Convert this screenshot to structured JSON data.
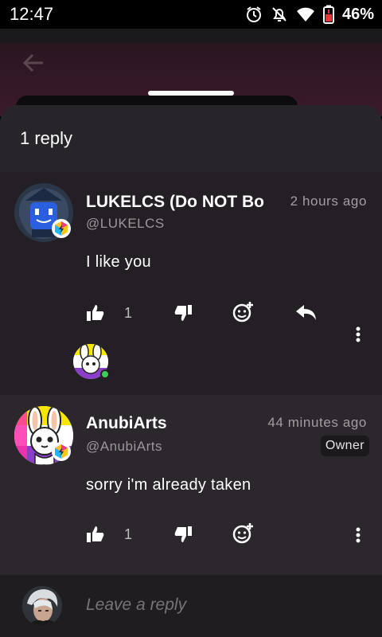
{
  "status_bar": {
    "time": "12:47",
    "battery": "46%",
    "icons": [
      "alarm-icon",
      "bell-off-icon",
      "wifi-icon",
      "battery-low-icon"
    ]
  },
  "sheet": {
    "title": "1 reply"
  },
  "comments": [
    {
      "name": "LUKELCS (Do NOT Bo",
      "handle": "@LUKELCS",
      "time": "2 hours ago",
      "text": "I like you",
      "likes": "1"
    },
    {
      "name": "AnubiArts",
      "handle": "@AnubiArts",
      "time": "44 minutes ago",
      "owner_label": "Owner",
      "text": "sorry i'm already taken",
      "likes": "1"
    }
  ],
  "reply_bar": {
    "placeholder": "Leave a reply"
  },
  "colors": {
    "sheet_bg": "#28252a",
    "comment_dark": "#231f24",
    "comment_light": "#2b272c",
    "muted_text": "#9a969b",
    "online_dot": "#3ccd5a"
  }
}
